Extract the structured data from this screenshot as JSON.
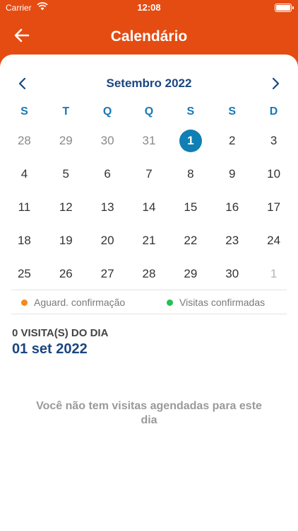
{
  "status_bar": {
    "carrier": "Carrier",
    "time": "12:08"
  },
  "nav": {
    "title": "Calendário",
    "back_icon": "arrow-left-icon"
  },
  "calendar": {
    "month_label": "Setembro 2022",
    "weekdays": [
      "S",
      "T",
      "Q",
      "Q",
      "S",
      "S",
      "D"
    ],
    "weeks": [
      [
        {
          "d": "28",
          "state": "prev"
        },
        {
          "d": "29",
          "state": "prev"
        },
        {
          "d": "30",
          "state": "prev"
        },
        {
          "d": "31",
          "state": "prev"
        },
        {
          "d": "1",
          "state": "selected"
        },
        {
          "d": "2",
          "state": "normal"
        },
        {
          "d": "3",
          "state": "normal"
        }
      ],
      [
        {
          "d": "4",
          "state": "normal"
        },
        {
          "d": "5",
          "state": "normal"
        },
        {
          "d": "6",
          "state": "normal"
        },
        {
          "d": "7",
          "state": "normal"
        },
        {
          "d": "8",
          "state": "normal"
        },
        {
          "d": "9",
          "state": "normal"
        },
        {
          "d": "10",
          "state": "normal"
        }
      ],
      [
        {
          "d": "11",
          "state": "normal"
        },
        {
          "d": "12",
          "state": "normal"
        },
        {
          "d": "13",
          "state": "normal"
        },
        {
          "d": "14",
          "state": "normal"
        },
        {
          "d": "15",
          "state": "normal"
        },
        {
          "d": "16",
          "state": "normal"
        },
        {
          "d": "17",
          "state": "normal"
        }
      ],
      [
        {
          "d": "18",
          "state": "normal"
        },
        {
          "d": "19",
          "state": "normal"
        },
        {
          "d": "20",
          "state": "normal"
        },
        {
          "d": "21",
          "state": "normal"
        },
        {
          "d": "22",
          "state": "normal"
        },
        {
          "d": "23",
          "state": "normal"
        },
        {
          "d": "24",
          "state": "normal"
        }
      ],
      [
        {
          "d": "25",
          "state": "normal"
        },
        {
          "d": "26",
          "state": "normal"
        },
        {
          "d": "27",
          "state": "normal"
        },
        {
          "d": "28",
          "state": "normal"
        },
        {
          "d": "29",
          "state": "normal"
        },
        {
          "d": "30",
          "state": "normal"
        },
        {
          "d": "1",
          "state": "next"
        }
      ]
    ]
  },
  "legend": {
    "pending_label": "Aguard. confirmação",
    "pending_color": "#f28a1e",
    "confirmed_label": "Visitas confirmadas",
    "confirmed_color": "#22c152"
  },
  "visits": {
    "count_label": "0 VISITA(S) DO DIA",
    "date_label": "01 set 2022",
    "empty_message": "Você não tem visitas agendadas para este dia"
  },
  "colors": {
    "header_bg": "#e44c12",
    "accent_blue": "#1a4680",
    "selected_day": "#0f7fb4"
  }
}
